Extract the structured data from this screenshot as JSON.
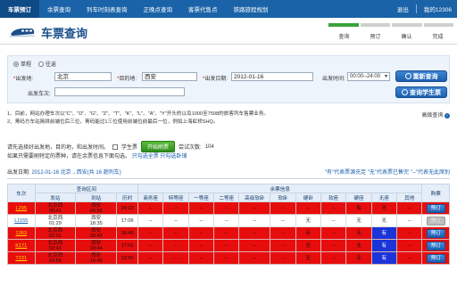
{
  "nav": {
    "tabs": [
      "车票预订",
      "余票查询",
      "列车时刻表查询",
      "正晚点查询",
      "客票代售点",
      "铁路旅程规划"
    ],
    "logout": "退出",
    "my12306": "我的12306"
  },
  "header": {
    "title": "车票查询",
    "steps": [
      "查询",
      "预订",
      "确认",
      "完成"
    ]
  },
  "form": {
    "trip_type": {
      "one_way": "单程",
      "round_trip": "往返",
      "selected": "单程"
    },
    "from_label": "出发地:",
    "from_value": "北京",
    "to_label": "目的地:",
    "to_value": "西安",
    "date_label": "出发日期:",
    "date_value": "2012-01-16",
    "time_label": "出发时间:",
    "time_value": "00:00--24:00",
    "train_label": "出发车次:",
    "train_value": "",
    "search_button": "重新查询",
    "student_button": "查询学生票"
  },
  "notice": {
    "line1": "1、目前，网站办理车次以\"C\"、\"D\"、\"G\"、\"Z\"、\"T\"、\"K\"、\"L\"、\"A\"、\"Y\"开头的以及1000至7598的旅客列车售票业务。",
    "line2": "2、菁码方车站简拼前端位后三位，菁码能过1三位使用前端位前最后一位，例如上海虹桥SHQ。",
    "advanced": "高级查询"
  },
  "filter": {
    "prompt": "请先选择好出发地，目的地，和出发时间。",
    "student_label": "学生票",
    "refresh_button": "开始刷票",
    "attempts_label": "尝试次数:",
    "attempts_value": "104",
    "line2_text": "如果只需要刷特定的票种，请在余票信息下面勾选。",
    "select_all": "只勾选全票",
    "select_sleeper": "只勾选卧铺"
  },
  "result": {
    "date_label": "出发日期:",
    "date": "2012-01-16",
    "route": "北京→西安(共 16 趟列车)",
    "legend": "\"有\"代表票源充足 \"无\"代表票已售完 \"--\"代表无此席别"
  },
  "table": {
    "group_headers": {
      "train": "车次",
      "range": "查询区间",
      "seats": "余票信息",
      "book": "购票"
    },
    "sub_headers": [
      "发站",
      "到站",
      "历时",
      "商务座",
      "特等座",
      "一等座",
      "二等座",
      "高级软卧",
      "软卧",
      "硬卧",
      "软座",
      "硬座",
      "无座",
      "其他"
    ],
    "rows": [
      {
        "style": "red",
        "train": "L295",
        "from": "北京西",
        "from_time": "00:41",
        "to": "西安",
        "to_time": "00:55",
        "duration": "24:23",
        "seats": [
          "--",
          "--",
          "--",
          "--",
          "--",
          "--",
          "--",
          "--",
          "有",
          "无",
          "--"
        ],
        "blue": [],
        "book": "预订",
        "book_disabled": false
      },
      {
        "style": "white",
        "train": "L1155",
        "from": "北京西",
        "from_time": "01:29",
        "to": "西安",
        "to_time": "18:35",
        "duration": "17:06",
        "seats": [
          "--",
          "--",
          "--",
          "--",
          "--",
          "--",
          "无",
          "--",
          "无",
          "无",
          "--"
        ],
        "blue": [],
        "book": "预订",
        "book_disabled": true
      },
      {
        "style": "red",
        "train": "1363",
        "from": "北京西",
        "from_time": "02:01",
        "to": "西安",
        "to_time": "20:42",
        "duration": "18:49",
        "seats": [
          "--",
          "--",
          "--",
          "--",
          "--",
          "--",
          "无",
          "--",
          "无",
          "有",
          "--"
        ],
        "blue": [
          9
        ],
        "book": "预订",
        "book_disabled": false
      },
      {
        "style": "red",
        "train": "K171",
        "from": "北京西",
        "from_time": "02:43",
        "to": "西安",
        "to_time": "19:44",
        "duration": "17:01",
        "seats": [
          "--",
          "--",
          "--",
          "--",
          "--",
          "--",
          "无",
          "--",
          "无",
          "有",
          "--"
        ],
        "blue": [
          9
        ],
        "book": "预订",
        "book_disabled": false
      },
      {
        "style": "red",
        "train": "T231",
        "from": "北京西",
        "from_time": "03:56",
        "to": "西安",
        "to_time": "16:46",
        "duration": "12:50",
        "seats": [
          "--",
          "--",
          "--",
          "--",
          "--",
          "--",
          "无",
          "--",
          "无",
          "有",
          "--"
        ],
        "blue": [
          9
        ],
        "book": "预订",
        "book_disabled": false
      }
    ]
  },
  "colors": {
    "nav": "#1a63a8",
    "row_red": "#e80d0d",
    "blue_cell": "#1a34d8",
    "step_done": "#39a43a"
  }
}
